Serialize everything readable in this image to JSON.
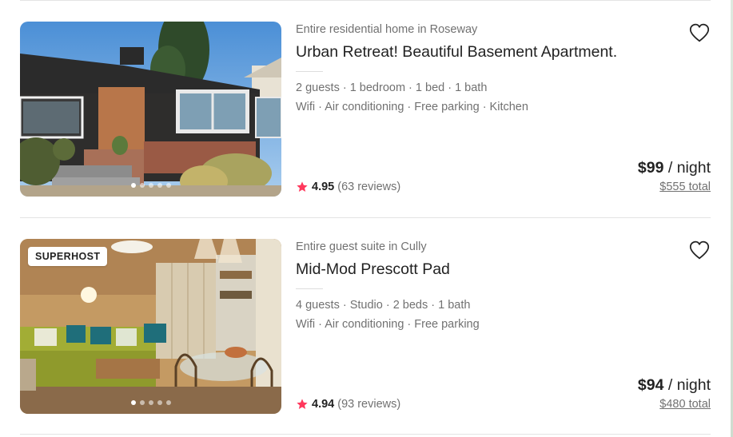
{
  "listings": [
    {
      "type_location": "Entire residential home in Roseway",
      "title": "Urban Retreat! Beautiful Basement Apartment.",
      "details": "2 guests · 1 bedroom · 1 bed · 1 bath",
      "amenities": "Wifi · Air conditioning · Free parking · Kitchen",
      "rating": "4.95",
      "reviews": "(63 reviews)",
      "price": "$99",
      "price_unit": " / night",
      "total": "$555 total",
      "badge": "",
      "photo_subject": "house-exterior",
      "photo_count_dots": 5,
      "active_dot": 0
    },
    {
      "type_location": "Entire guest suite in Cully",
      "title": "Mid-Mod Prescott Pad",
      "details": "4 guests · Studio · 2 beds · 1 bath",
      "amenities": "Wifi · Air conditioning · Free parking",
      "rating": "4.94",
      "reviews": "(93 reviews)",
      "price": "$94",
      "price_unit": " / night",
      "total": "$480 total",
      "badge": "SUPERHOST",
      "photo_subject": "living-room-interior",
      "photo_count_dots": 5,
      "active_dot": 0
    }
  ],
  "colors": {
    "star": "#ff385c",
    "muted_text": "#717171",
    "primary_text": "#222222",
    "divider": "#e4e4e4"
  },
  "icons": {
    "favorite": "heart-icon",
    "rating": "star-icon"
  }
}
